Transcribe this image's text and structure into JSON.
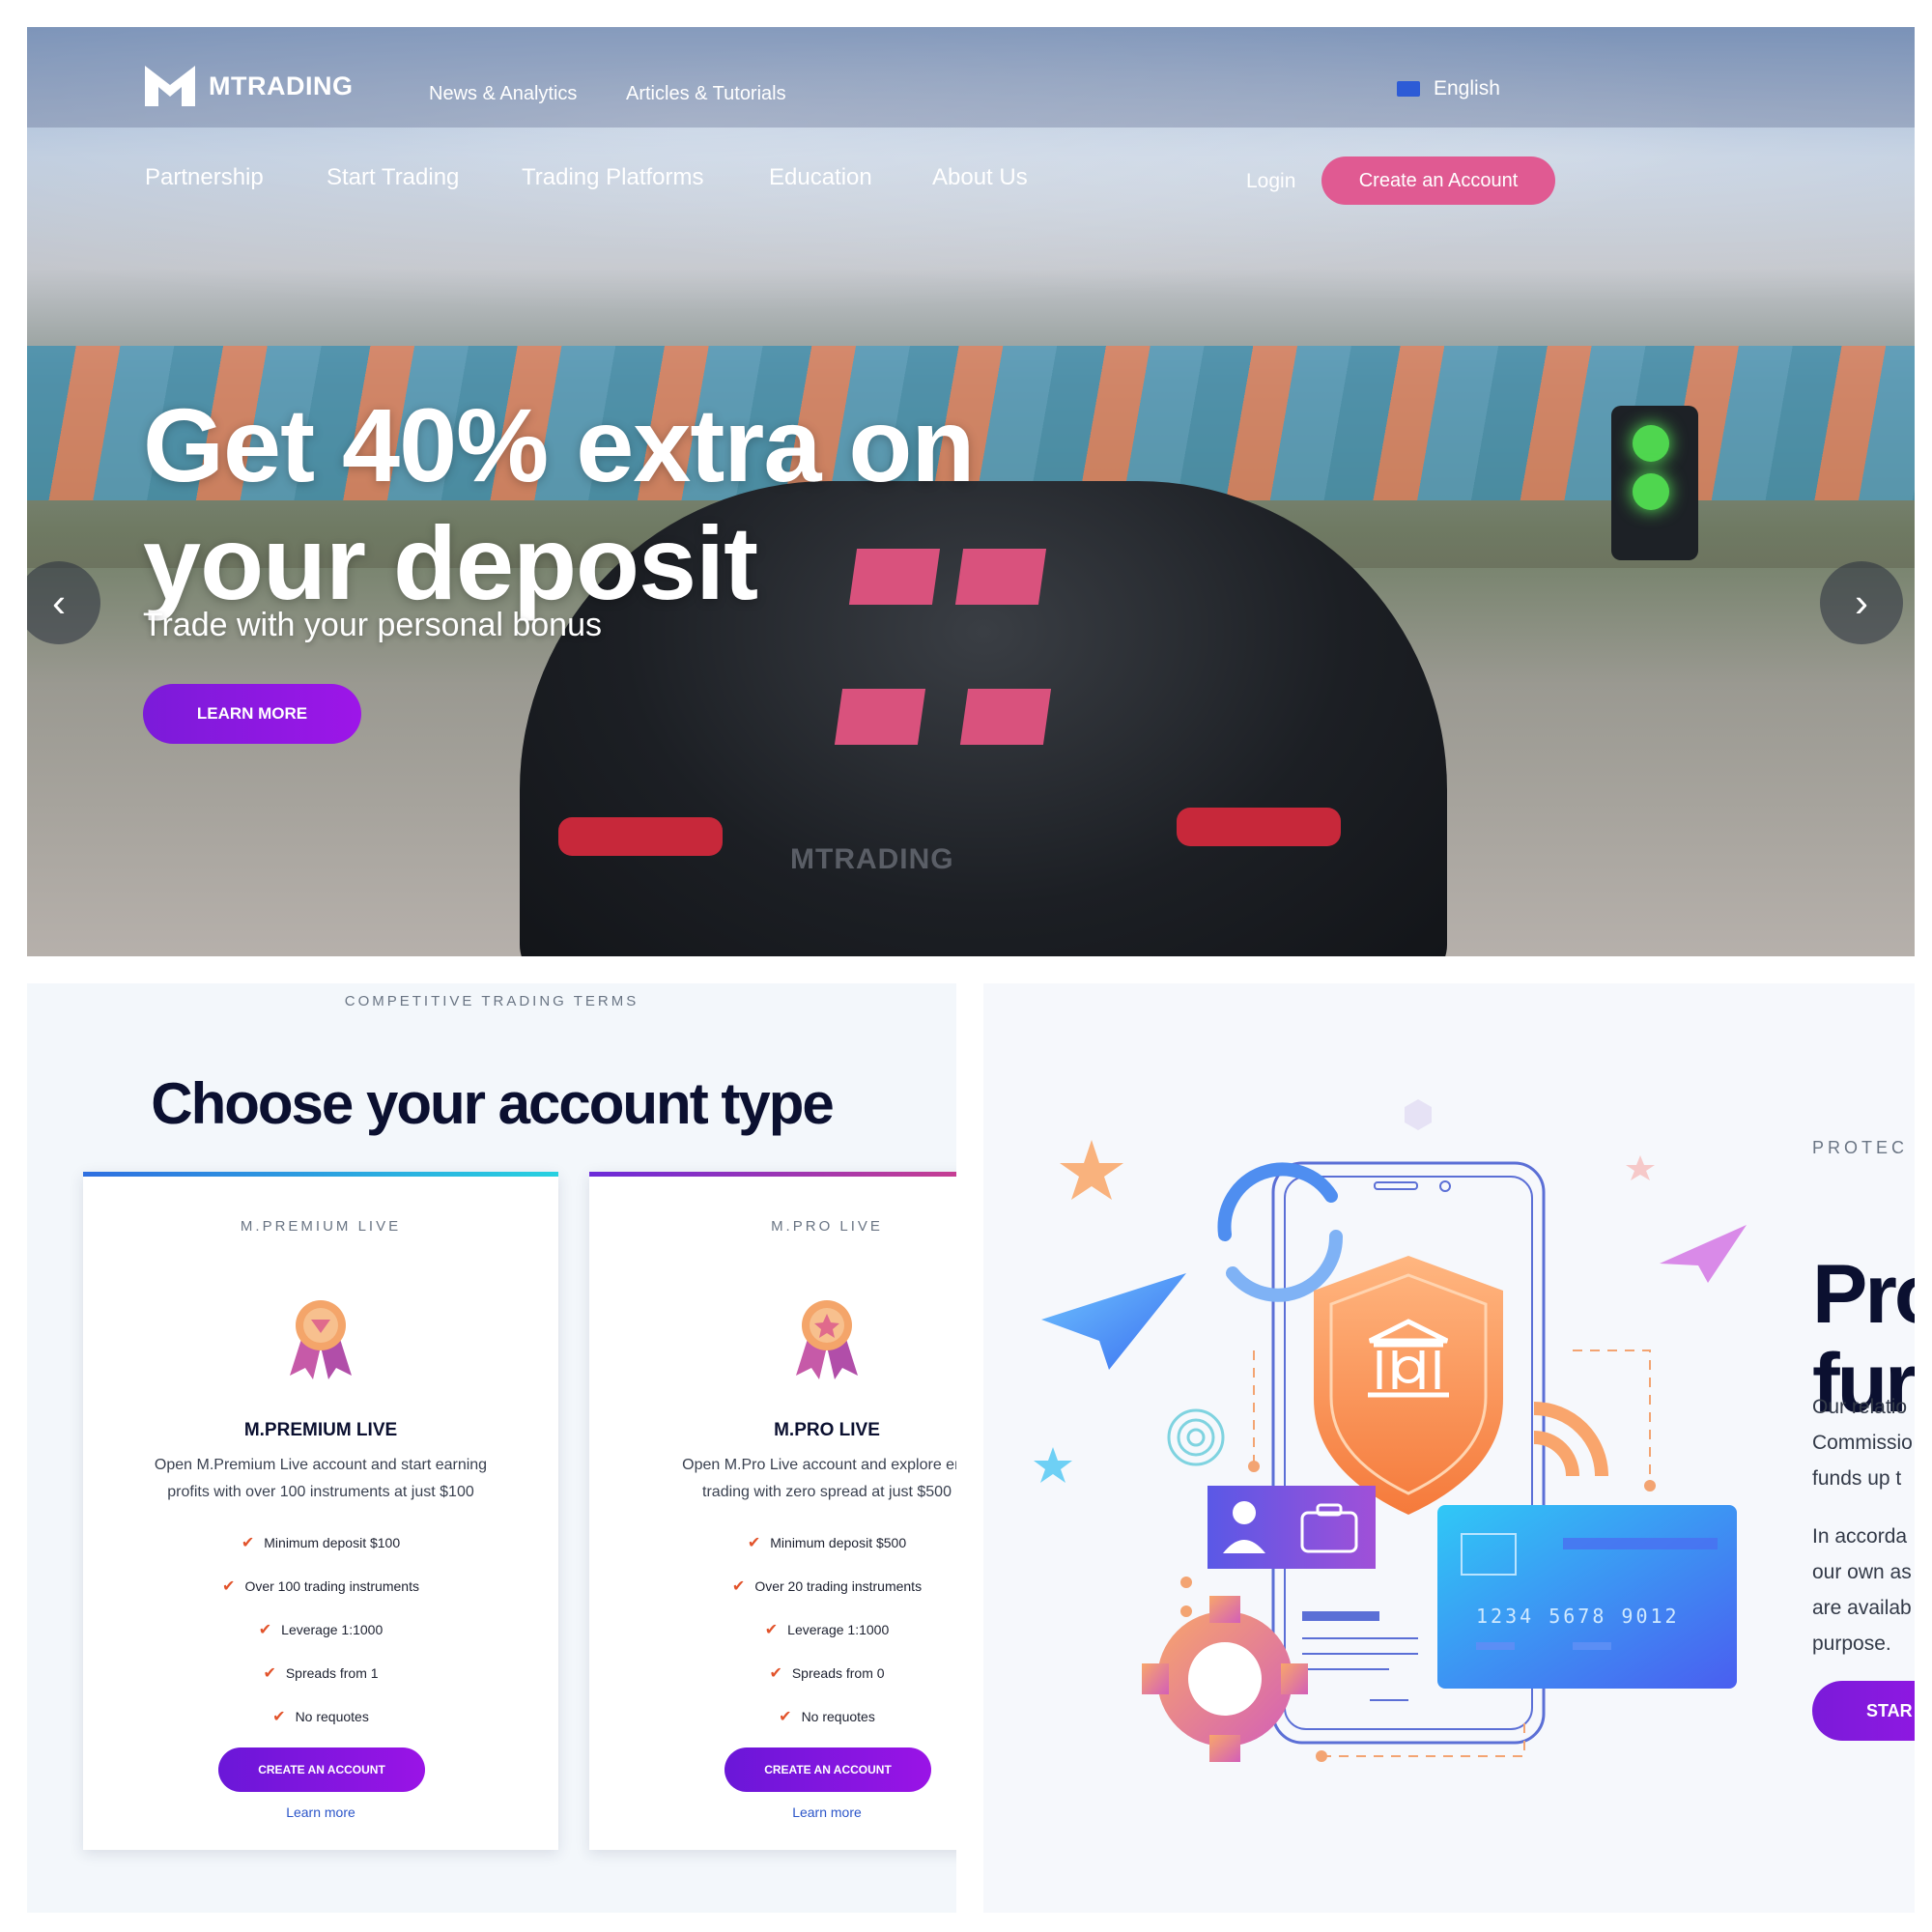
{
  "header": {
    "logo_text": "MTRADING",
    "top_links": [
      "News & Analytics",
      "Articles & Tutorials"
    ],
    "language": "English",
    "main_nav": [
      "Partnership",
      "Start Trading",
      "Trading Platforms",
      "Education",
      "About Us"
    ],
    "login": "Login",
    "create_account": "Create an Account"
  },
  "hero": {
    "title_line1": "Get 40% extra on",
    "title_line2": "your deposit",
    "subtitle": "Trade with your personal bonus",
    "cta": "LEARN MORE",
    "car_logo": "MTRADING",
    "prev_arrow": "‹",
    "next_arrow": "›"
  },
  "accounts": {
    "eyebrow": "COMPETITIVE TRADING TERMS",
    "title": "Choose your account type",
    "cards": [
      {
        "eyebrow": "M.PREMIUM LIVE",
        "name": "M.PREMIUM LIVE",
        "desc_line1": "Open M.Premium Live account and start earning",
        "desc_line2": "profits with over 100 instruments at just $100",
        "features": [
          "Minimum deposit $100",
          "Over 100 trading instruments",
          "Leverage 1:1000",
          "Spreads from 1",
          "No requotes"
        ],
        "cta": "CREATE AN ACCOUNT",
        "link": "Learn more",
        "accent_from": "#2f6fe0",
        "accent_to": "#27d1e0"
      },
      {
        "eyebrow": "M.PRO LIVE",
        "name": "M.PRO LIVE",
        "desc_line1": "Open M.Pro Live account and explore enh",
        "desc_line2": "trading with zero spread at just $500",
        "features": [
          "Minimum deposit $500",
          "Over 20 trading instruments",
          "Leverage 1:1000",
          "Spreads from 0",
          "No requotes"
        ],
        "cta": "CREATE AN ACCOUNT",
        "link": "Learn more",
        "accent_from": "#6c2bd9",
        "accent_to": "#e0447e"
      }
    ]
  },
  "protect": {
    "eyebrow": "PROTEC",
    "title": "Pro\nfur",
    "para1": [
      "Our relatio",
      "Commissio",
      "funds up t"
    ],
    "para2": [
      "In accorda",
      "our own as",
      "are availab",
      "purpose."
    ],
    "cta": "STAR",
    "card_number": "1234 5678 9012"
  },
  "colors": {
    "brand_purple": "#7b1bd9",
    "brand_pink": "#e05a92",
    "check": "#e2532b",
    "link": "#2b55c9",
    "heading": "#0b1030"
  }
}
